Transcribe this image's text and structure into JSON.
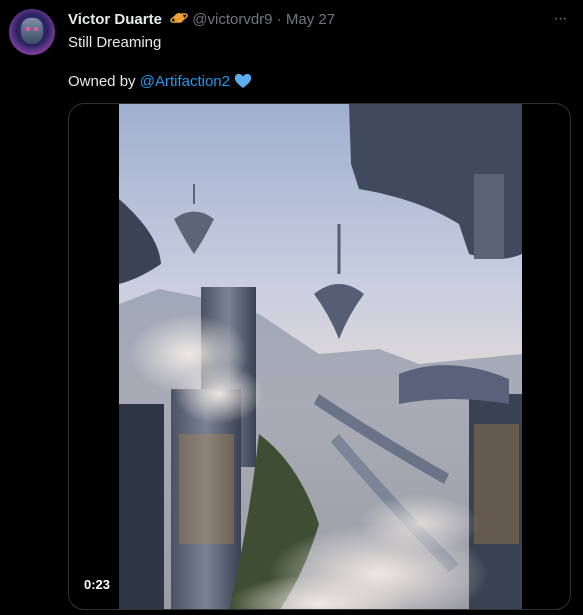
{
  "tweet": {
    "author_name": "Victor Duarte",
    "handle": "@victorvdr9",
    "separator": "·",
    "date": "May 27",
    "badge_icon": "planet-emoji",
    "text_line1": "Still Dreaming",
    "owned_prefix": "Owned by ",
    "owned_mention": "@Artifaction2",
    "heart_icon": "blue-heart-emoji",
    "more_icon": "···",
    "video": {
      "duration": "0:23"
    },
    "colors": {
      "background": "#000000",
      "text": "#e7e9ea",
      "secondary": "#71767b",
      "link": "#1d9bf0",
      "border": "#2f3336"
    }
  }
}
